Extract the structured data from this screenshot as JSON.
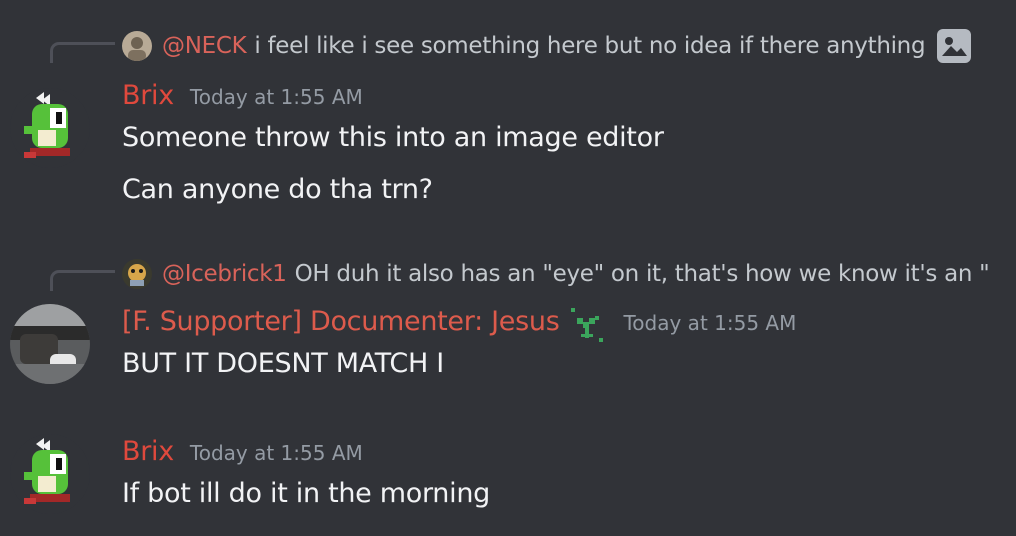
{
  "messages": [
    {
      "reply": {
        "mention": "@NECK",
        "text": "i feel like i see something here but no idea if there anything",
        "attachment_icon": "image-icon"
      },
      "author": "Brix",
      "author_color": "#e0493d",
      "timestamp": "Today at 1:55 AM",
      "lines": [
        "Someone throw this into an image editor",
        "Can anyone do tha trn?"
      ]
    },
    {
      "reply": {
        "mention": "@Icebrick1",
        "text": "OH duh it also has an \"eye\" on it, that's how we know it's an \""
      },
      "author": "[F. Supporter] Documenter: Jesus",
      "author_color": "#dd5b4c",
      "badge_icon": "sprout-icon",
      "timestamp": "Today at 1:55 AM",
      "lines": [
        "BUT IT DOESNT MATCH I"
      ]
    },
    {
      "author": "Brix",
      "author_color": "#e0493d",
      "timestamp": "Today at 1:55 AM",
      "lines": [
        "If bot ill do it in the morning"
      ]
    }
  ]
}
